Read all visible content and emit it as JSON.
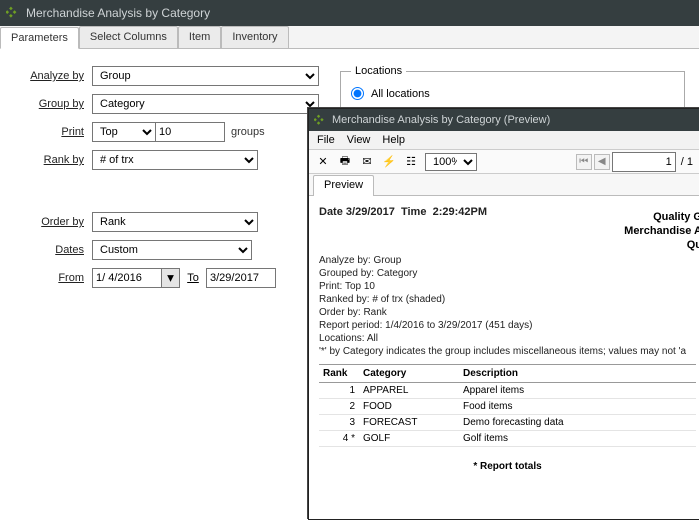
{
  "main": {
    "title": "Merchandise Analysis by Category",
    "tabs": [
      "Parameters",
      "Select Columns",
      "Item",
      "Inventory"
    ],
    "active_tab": 0
  },
  "params": {
    "analyze_by": {
      "label": "Analyze by",
      "value": "Group"
    },
    "group_by": {
      "label": "Group by",
      "value": "Category"
    },
    "print": {
      "label": "Print",
      "mode": "Top",
      "count": "10",
      "suffix": "groups"
    },
    "rank_by": {
      "label": "Rank by",
      "value": "# of trx"
    },
    "order_by": {
      "label": "Order by",
      "value": "Rank"
    },
    "dates": {
      "label": "Dates",
      "value": "Custom"
    },
    "from": {
      "label": "From",
      "value": "1/ 4/2016",
      "to_label": "To",
      "to_value": "3/29/2017"
    }
  },
  "locations": {
    "legend": "Locations",
    "all_label": "All locations",
    "all_checked": true
  },
  "preview": {
    "title": "Merchandise Analysis by Category (Preview)",
    "menu": [
      "File",
      "View",
      "Help"
    ],
    "zoom": "100%",
    "page_current": "1",
    "page_total": "/ 1",
    "tab": "Preview",
    "date_line": {
      "date_label": "Date",
      "date": "3/29/2017",
      "time_label": "Time",
      "time": "2:29:42PM"
    },
    "header_right": [
      "Quality G",
      "Merchandise A",
      "Qu"
    ],
    "meta_lines": [
      "Analyze by: Group",
      "Grouped by: Category",
      "Print: Top  10",
      "Ranked by: # of trx (shaded)",
      "Order by: Rank",
      "Report period: 1/4/2016 to 3/29/2017 (451 days)",
      "Locations: All",
      "'*' by Category indicates the group includes miscellaneous items; values may not 'a"
    ],
    "columns": [
      "Rank",
      "Category",
      "Description"
    ],
    "rows": [
      {
        "rank": "1",
        "category": "APPAREL",
        "description": "Apparel items"
      },
      {
        "rank": "2",
        "category": "FOOD",
        "description": "Food items"
      },
      {
        "rank": "3",
        "category": "FORECAST",
        "description": "Demo forecasting data"
      },
      {
        "rank": "4 *",
        "category": "GOLF",
        "description": "Golf items"
      }
    ],
    "footer": "*  Report totals"
  },
  "chart_data": {
    "type": "table",
    "title": "Merchandise Analysis by Category",
    "columns": [
      "Rank",
      "Category",
      "Description"
    ],
    "rows": [
      [
        1,
        "APPAREL",
        "Apparel items"
      ],
      [
        2,
        "FOOD",
        "Food items"
      ],
      [
        3,
        "FORECAST",
        "Demo forecasting data"
      ],
      [
        4,
        "GOLF",
        "Golf items"
      ]
    ],
    "parameters": {
      "analyze_by": "Group",
      "group_by": "Category",
      "print": "Top 10",
      "rank_by": "# of trx",
      "order_by": "Rank",
      "report_period": "1/4/2016 to 3/29/2017 (451 days)",
      "locations": "All"
    }
  }
}
